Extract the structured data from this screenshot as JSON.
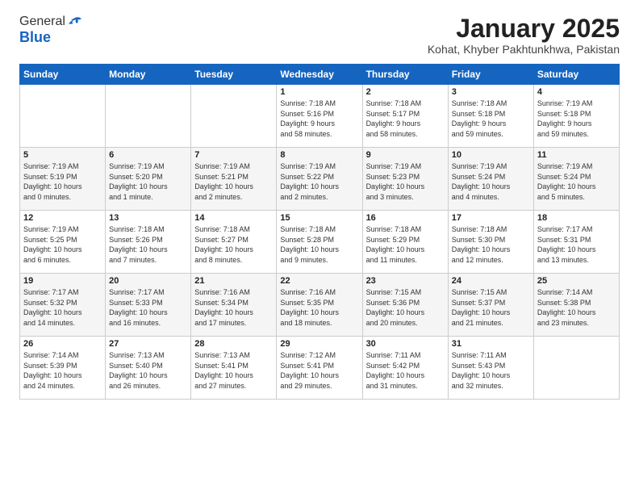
{
  "header": {
    "logo_general": "General",
    "logo_blue": "Blue",
    "title": "January 2025",
    "subtitle": "Kohat, Khyber Pakhtunkhwa, Pakistan"
  },
  "weekdays": [
    "Sunday",
    "Monday",
    "Tuesday",
    "Wednesday",
    "Thursday",
    "Friday",
    "Saturday"
  ],
  "weeks": [
    [
      {
        "day": "",
        "info": ""
      },
      {
        "day": "",
        "info": ""
      },
      {
        "day": "",
        "info": ""
      },
      {
        "day": "1",
        "info": "Sunrise: 7:18 AM\nSunset: 5:16 PM\nDaylight: 9 hours\nand 58 minutes."
      },
      {
        "day": "2",
        "info": "Sunrise: 7:18 AM\nSunset: 5:17 PM\nDaylight: 9 hours\nand 58 minutes."
      },
      {
        "day": "3",
        "info": "Sunrise: 7:18 AM\nSunset: 5:18 PM\nDaylight: 9 hours\nand 59 minutes."
      },
      {
        "day": "4",
        "info": "Sunrise: 7:19 AM\nSunset: 5:18 PM\nDaylight: 9 hours\nand 59 minutes."
      }
    ],
    [
      {
        "day": "5",
        "info": "Sunrise: 7:19 AM\nSunset: 5:19 PM\nDaylight: 10 hours\nand 0 minutes."
      },
      {
        "day": "6",
        "info": "Sunrise: 7:19 AM\nSunset: 5:20 PM\nDaylight: 10 hours\nand 1 minute."
      },
      {
        "day": "7",
        "info": "Sunrise: 7:19 AM\nSunset: 5:21 PM\nDaylight: 10 hours\nand 2 minutes."
      },
      {
        "day": "8",
        "info": "Sunrise: 7:19 AM\nSunset: 5:22 PM\nDaylight: 10 hours\nand 2 minutes."
      },
      {
        "day": "9",
        "info": "Sunrise: 7:19 AM\nSunset: 5:23 PM\nDaylight: 10 hours\nand 3 minutes."
      },
      {
        "day": "10",
        "info": "Sunrise: 7:19 AM\nSunset: 5:24 PM\nDaylight: 10 hours\nand 4 minutes."
      },
      {
        "day": "11",
        "info": "Sunrise: 7:19 AM\nSunset: 5:24 PM\nDaylight: 10 hours\nand 5 minutes."
      }
    ],
    [
      {
        "day": "12",
        "info": "Sunrise: 7:19 AM\nSunset: 5:25 PM\nDaylight: 10 hours\nand 6 minutes."
      },
      {
        "day": "13",
        "info": "Sunrise: 7:18 AM\nSunset: 5:26 PM\nDaylight: 10 hours\nand 7 minutes."
      },
      {
        "day": "14",
        "info": "Sunrise: 7:18 AM\nSunset: 5:27 PM\nDaylight: 10 hours\nand 8 minutes."
      },
      {
        "day": "15",
        "info": "Sunrise: 7:18 AM\nSunset: 5:28 PM\nDaylight: 10 hours\nand 9 minutes."
      },
      {
        "day": "16",
        "info": "Sunrise: 7:18 AM\nSunset: 5:29 PM\nDaylight: 10 hours\nand 11 minutes."
      },
      {
        "day": "17",
        "info": "Sunrise: 7:18 AM\nSunset: 5:30 PM\nDaylight: 10 hours\nand 12 minutes."
      },
      {
        "day": "18",
        "info": "Sunrise: 7:17 AM\nSunset: 5:31 PM\nDaylight: 10 hours\nand 13 minutes."
      }
    ],
    [
      {
        "day": "19",
        "info": "Sunrise: 7:17 AM\nSunset: 5:32 PM\nDaylight: 10 hours\nand 14 minutes."
      },
      {
        "day": "20",
        "info": "Sunrise: 7:17 AM\nSunset: 5:33 PM\nDaylight: 10 hours\nand 16 minutes."
      },
      {
        "day": "21",
        "info": "Sunrise: 7:16 AM\nSunset: 5:34 PM\nDaylight: 10 hours\nand 17 minutes."
      },
      {
        "day": "22",
        "info": "Sunrise: 7:16 AM\nSunset: 5:35 PM\nDaylight: 10 hours\nand 18 minutes."
      },
      {
        "day": "23",
        "info": "Sunrise: 7:15 AM\nSunset: 5:36 PM\nDaylight: 10 hours\nand 20 minutes."
      },
      {
        "day": "24",
        "info": "Sunrise: 7:15 AM\nSunset: 5:37 PM\nDaylight: 10 hours\nand 21 minutes."
      },
      {
        "day": "25",
        "info": "Sunrise: 7:14 AM\nSunset: 5:38 PM\nDaylight: 10 hours\nand 23 minutes."
      }
    ],
    [
      {
        "day": "26",
        "info": "Sunrise: 7:14 AM\nSunset: 5:39 PM\nDaylight: 10 hours\nand 24 minutes."
      },
      {
        "day": "27",
        "info": "Sunrise: 7:13 AM\nSunset: 5:40 PM\nDaylight: 10 hours\nand 26 minutes."
      },
      {
        "day": "28",
        "info": "Sunrise: 7:13 AM\nSunset: 5:41 PM\nDaylight: 10 hours\nand 27 minutes."
      },
      {
        "day": "29",
        "info": "Sunrise: 7:12 AM\nSunset: 5:41 PM\nDaylight: 10 hours\nand 29 minutes."
      },
      {
        "day": "30",
        "info": "Sunrise: 7:11 AM\nSunset: 5:42 PM\nDaylight: 10 hours\nand 31 minutes."
      },
      {
        "day": "31",
        "info": "Sunrise: 7:11 AM\nSunset: 5:43 PM\nDaylight: 10 hours\nand 32 minutes."
      },
      {
        "day": "",
        "info": ""
      }
    ]
  ]
}
